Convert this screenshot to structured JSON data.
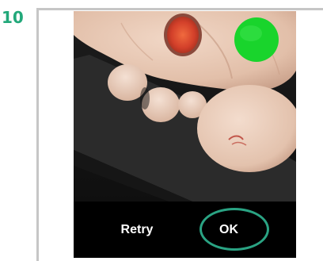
{
  "step": {
    "number": "10"
  },
  "dialog": {
    "retry_label": "Retry",
    "ok_label": "OK"
  },
  "colors": {
    "step_number": "#22a87a",
    "highlight_ring": "#2aa383",
    "marker_green": "#19d42c",
    "marker_red": "#d9442c",
    "clay": "#e6c7b4",
    "background_surface": "#1a1a1a"
  },
  "icons": {
    "highlight": "ellipse-outline"
  }
}
